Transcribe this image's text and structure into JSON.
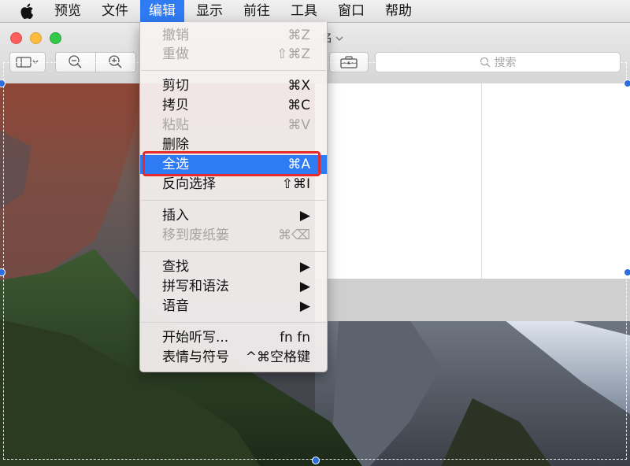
{
  "menubar": {
    "items": [
      {
        "label": "预览"
      },
      {
        "label": "文件"
      },
      {
        "label": "编辑"
      },
      {
        "label": "显示"
      },
      {
        "label": "前往"
      },
      {
        "label": "工具"
      },
      {
        "label": "窗口"
      },
      {
        "label": "帮助"
      }
    ],
    "active_item": "编辑"
  },
  "window": {
    "title_partial": "名",
    "search_placeholder": "搜索"
  },
  "edit_menu": {
    "items": [
      {
        "label": "撤销",
        "shortcut": "⌘Z",
        "enabled": false
      },
      {
        "label": "重做",
        "shortcut": "⇧⌘Z",
        "enabled": false
      },
      {
        "label": "剪切",
        "shortcut": "⌘X",
        "enabled": true
      },
      {
        "label": "拷贝",
        "shortcut": "⌘C",
        "enabled": true
      },
      {
        "label": "粘贴",
        "shortcut": "⌘V",
        "enabled": false
      },
      {
        "label": "删除",
        "shortcut": "",
        "enabled": true
      },
      {
        "label": "全选",
        "shortcut": "⌘A",
        "enabled": true,
        "selected": true
      },
      {
        "label": "反向选择",
        "shortcut": "⇧⌘I",
        "enabled": true
      },
      {
        "label": "插入",
        "shortcut": "▶",
        "enabled": true
      },
      {
        "label": "移到废纸篓",
        "shortcut": "⌘⌫",
        "enabled": false
      },
      {
        "label": "查找",
        "shortcut": "▶",
        "enabled": true
      },
      {
        "label": "拼写和语法",
        "shortcut": "▶",
        "enabled": true
      },
      {
        "label": "语音",
        "shortcut": "▶",
        "enabled": true
      },
      {
        "label": "开始听写...",
        "shortcut": "fn fn",
        "enabled": true
      },
      {
        "label": "表情与符号",
        "shortcut": "^⌘空格键",
        "enabled": true
      }
    ]
  },
  "colors": {
    "menu_highlight": "#2f7bf4",
    "annotation_red": "#e32b2b"
  },
  "icons": [
    "apple-icon",
    "sidebar-toggle-icon",
    "zoom-out-icon",
    "zoom-in-icon",
    "toolbox-icon",
    "search-icon"
  ]
}
